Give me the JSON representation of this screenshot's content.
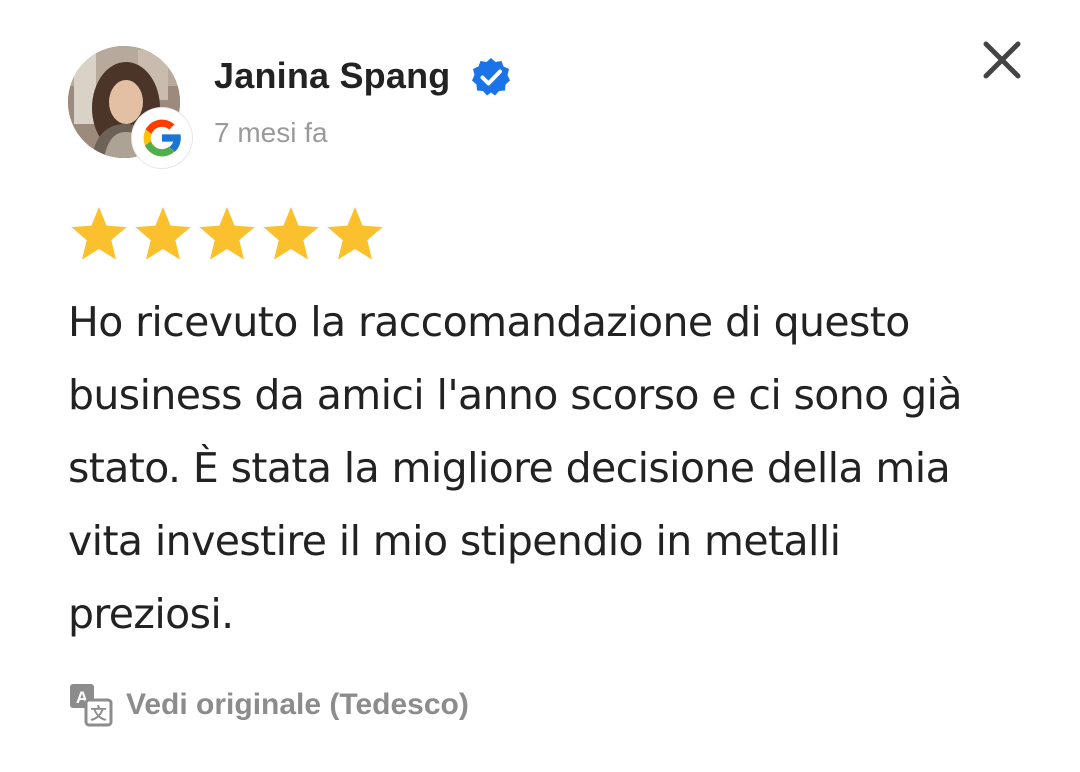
{
  "review": {
    "reviewer_name": "Janina Spang",
    "time_ago": "7 mesi fa",
    "rating": 5,
    "rating_max": 5,
    "text": "Ho ricevuto la raccomandazione di questo business da amici l'anno scorso e ci sono già stato. È stata la migliore decisione della mia vita investire il mio stipendio in metalli preziosi.",
    "translate_label": "Vedi originale (Tedesco)"
  },
  "icons": {
    "close": "close-icon",
    "verified": "verified-badge-icon",
    "google": "google-logo-icon",
    "translate": "translate-icon",
    "star": "star-icon"
  },
  "colors": {
    "star": "#FBC02D",
    "verified": "#1A73E8",
    "muted_text": "#9A9A9A",
    "close": "#444444"
  }
}
